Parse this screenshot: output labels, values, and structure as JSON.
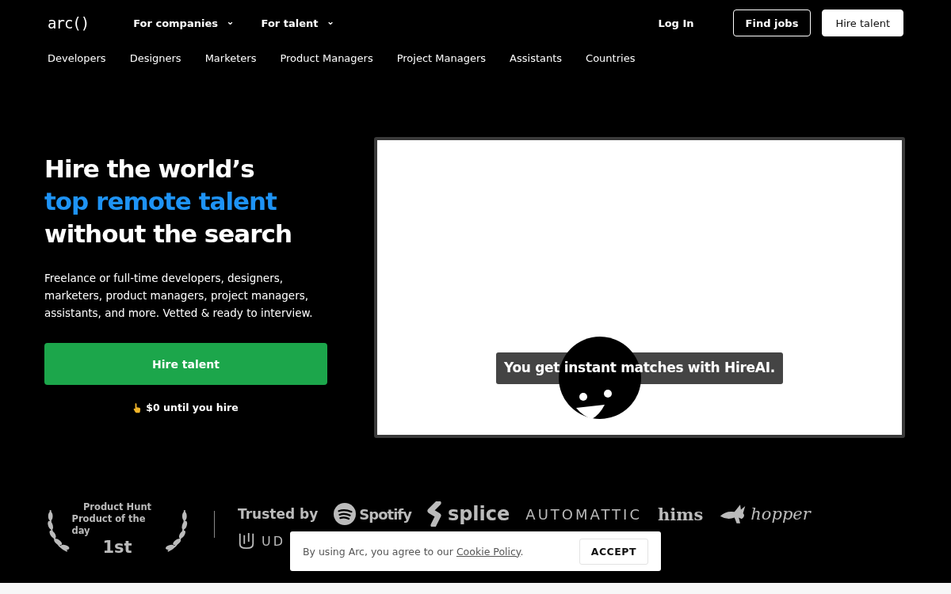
{
  "header": {
    "logo": "arc()",
    "menus": [
      {
        "label": "For companies",
        "caret": "⌄"
      },
      {
        "label": "For talent",
        "caret": "⌄"
      }
    ],
    "actions": [
      {
        "label": "Log In",
        "kind": "link"
      },
      {
        "label": "Find jobs",
        "kind": "outline"
      },
      {
        "label": "Hire talent",
        "kind": "solid"
      }
    ]
  },
  "categories": [
    "Developers",
    "Designers",
    "Marketers",
    "Product Managers",
    "Project Managers",
    "Assistants",
    "Countries"
  ],
  "hero": {
    "title_lines": [
      {
        "text": "Hire the world’s",
        "highlight": false
      },
      {
        "text": "top remote talent",
        "highlight": true
      },
      {
        "text": "without the search",
        "highlight": false
      }
    ],
    "description": "Freelance or full-time developers, designers, marketers, product managers, project managers, assistants, and more. Vetted & ready to interview.",
    "cta": "Hire talent",
    "note": "$0 until you hire"
  },
  "animation": {
    "caption": "You get instant matches with HireAI."
  },
  "award": {
    "lines": [
      "Product Hunt",
      "Product of the day"
    ],
    "rank": "1st"
  },
  "trusted": {
    "label": "Trusted by",
    "logos": [
      {
        "name": "Spotify",
        "kind": "spotify"
      },
      {
        "name": "splice",
        "kind": "splice"
      },
      {
        "name": "AUTOMATTIC",
        "kind": "automattic"
      },
      {
        "name": "hims",
        "kind": "hims"
      },
      {
        "name": "hopper",
        "kind": "hopper"
      },
      {
        "name": "UD",
        "kind": "udacity"
      }
    ]
  },
  "cookie_banner": {
    "text_before": "By using Arc, you agree to our ",
    "link": "Cookie Policy",
    "text_after": ".",
    "button": "ACCEPT"
  }
}
